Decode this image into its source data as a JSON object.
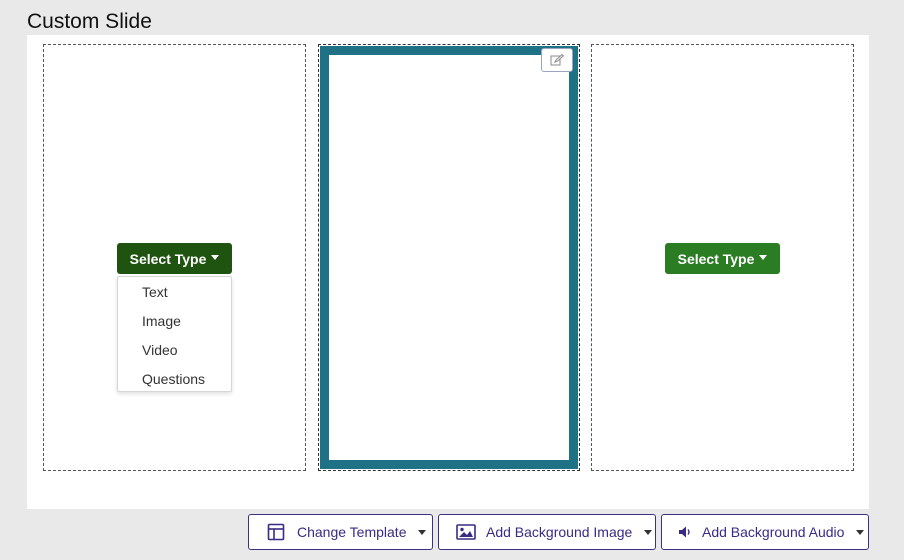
{
  "page": {
    "title": "Custom Slide"
  },
  "columns": {
    "left": {
      "select_type_label": "Select Type",
      "dropdown_open": true,
      "dropdown_items": [
        "Text",
        "Image",
        "Video",
        "Questions"
      ]
    },
    "middle": {
      "selected": true,
      "edit_icon": "edit-icon"
    },
    "right": {
      "select_type_label": "Select Type"
    }
  },
  "footer": {
    "change_template_label": "Change Template",
    "add_background_image_label": "Add Background Image",
    "add_background_audio_label": "Add Background Audio",
    "icons": [
      "template-icon",
      "image-icon",
      "speaker-icon"
    ]
  },
  "colors": {
    "selected_border": "#1f7185",
    "select_type_active": "#1e5310",
    "select_type": "#2a7d22",
    "footer_accent": "#3f2f80"
  }
}
